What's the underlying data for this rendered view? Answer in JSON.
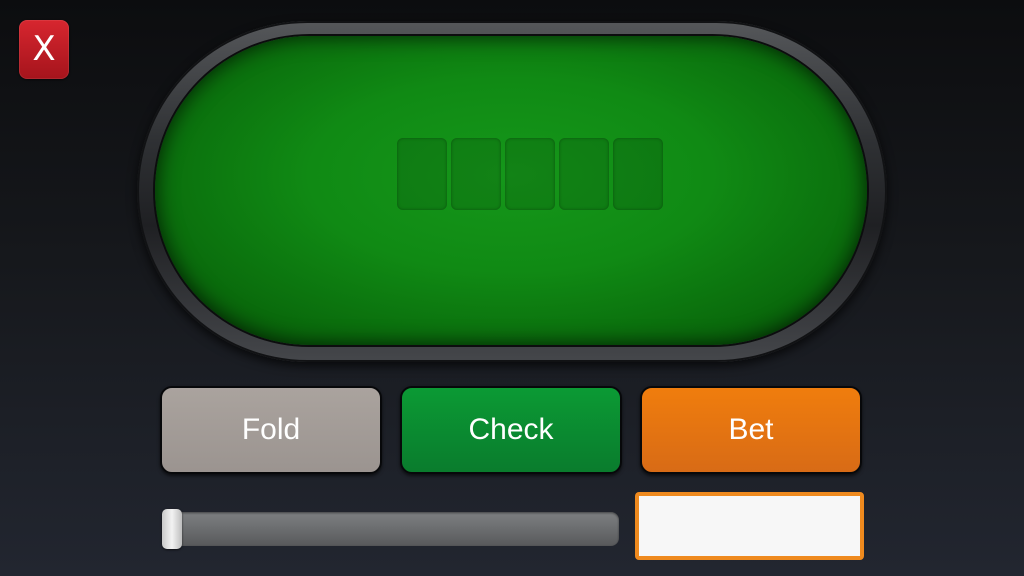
{
  "close_button": {
    "label": "X",
    "color": "#c81d26"
  },
  "table": {
    "felt_color": "#0f8a13",
    "community_card_slots": 5
  },
  "actions": {
    "fold_label": "Fold",
    "check_label": "Check",
    "bet_label": "Bet",
    "colors": {
      "fold": "#a39c98",
      "check": "#0a8a30",
      "bet": "#e77512"
    }
  },
  "bet_slider": {
    "value_fraction": 0.0
  },
  "bet_input": {
    "value": "",
    "placeholder": ""
  }
}
